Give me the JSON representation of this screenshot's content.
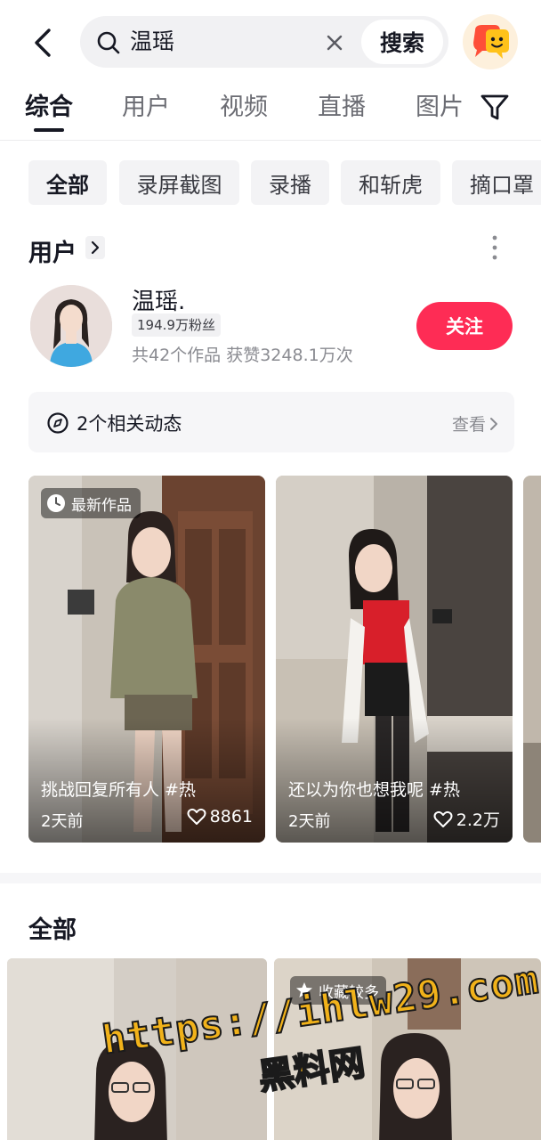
{
  "header": {
    "search_query": "温瑶",
    "search_button": "搜索"
  },
  "tabs": [
    {
      "label": "综合"
    },
    {
      "label": "用户"
    },
    {
      "label": "视频"
    },
    {
      "label": "直播"
    },
    {
      "label": "图片"
    }
  ],
  "chips": [
    {
      "label": "全部"
    },
    {
      "label": "录屏截图"
    },
    {
      "label": "录播"
    },
    {
      "label": "和斩虎"
    },
    {
      "label": "摘口罩"
    }
  ],
  "user_section": {
    "title": "用户",
    "name": "温瑶.",
    "fans": "194.9万粉丝",
    "stats": "共42个作品 获赞3248.1万次",
    "follow_label": "关注",
    "activity_text": "2个相关动态",
    "activity_link": "查看"
  },
  "videos": [
    {
      "badge": "最新作品",
      "title": "挑战回复所有人 #热",
      "time": "2天前",
      "likes": "8861"
    },
    {
      "badge": "",
      "title": "还以为你也想我呢 #热",
      "time": "2天前",
      "likes": "2.2万"
    }
  ],
  "all_section": {
    "title": "全部",
    "fav_badge": "收藏较多"
  },
  "watermark": {
    "url": "https://ihlw29.com",
    "name": "黑料网"
  },
  "colors": {
    "accent": "#fe2c55",
    "text_primary": "#161823",
    "text_secondary": "#8a8b91",
    "chip_bg": "#f3f3f5"
  }
}
